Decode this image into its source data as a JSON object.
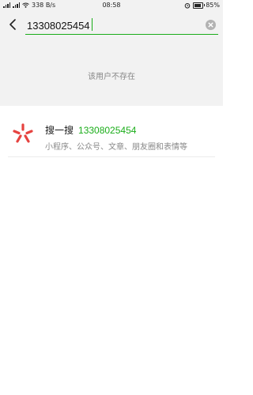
{
  "status_bar": {
    "speed": "338 B/s",
    "time": "08:58",
    "battery": "85%",
    "battery_level": 0.85
  },
  "search": {
    "query": "13308025454"
  },
  "empty_result": {
    "message": "该用户不存在"
  },
  "search_one_search": {
    "title": "搜一搜",
    "keyword": "13308025454",
    "description": "小程序、公众号、文章、朋友圈和表情等"
  },
  "colors": {
    "accent": "#1aad19",
    "icon_red": "#e64340"
  },
  "icons": {
    "back": "chevron-left-icon",
    "clear": "clear-circle-icon",
    "result": "search-one-search-icon"
  }
}
